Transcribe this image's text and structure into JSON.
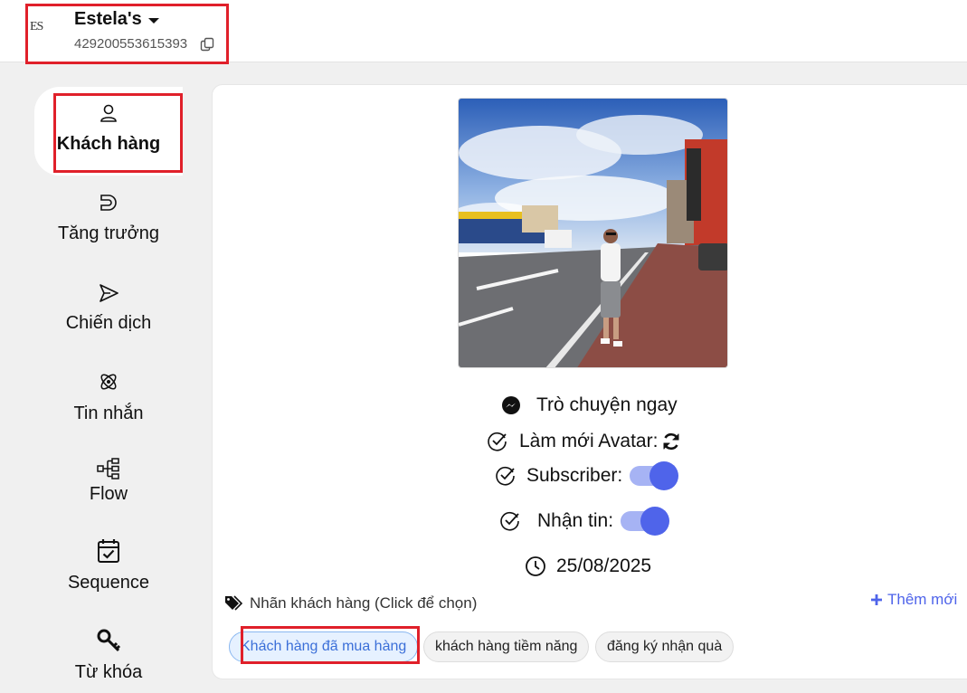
{
  "header": {
    "page_logo_text": "ES",
    "page_name": "Estela's",
    "page_id": "429200553615393"
  },
  "sidebar": {
    "items": [
      {
        "label": "Khách hàng",
        "icon": "user-icon",
        "active": true
      },
      {
        "label": "Tăng trưởng",
        "icon": "magnet-icon"
      },
      {
        "label": "Chiến dịch",
        "icon": "send-icon"
      },
      {
        "label": "Tin nhắn",
        "icon": "atom-icon"
      },
      {
        "label": "Flow",
        "icon": "flow-icon"
      },
      {
        "label": "Sequence",
        "icon": "calendar-check-icon"
      },
      {
        "label": "Từ khóa",
        "icon": "key-icon"
      }
    ]
  },
  "profile": {
    "chat_now": "Trò chuyện ngay",
    "refresh_avatar": "Làm mới Avatar:",
    "subscriber_label": "Subscriber:",
    "subscriber_on": true,
    "receive_label": "Nhận tin:",
    "receive_on": true,
    "date": "25/08/2025"
  },
  "tags": {
    "label": "Nhãn khách hàng (Click để chọn)",
    "add_new": "Thêm mới",
    "chips": [
      {
        "label": "Khách hàng đã mua hàng",
        "selected": true
      },
      {
        "label": "khách hàng tiềm năng",
        "selected": false
      },
      {
        "label": "đăng ký nhận quà",
        "selected": false
      }
    ]
  },
  "colors": {
    "accent": "#4f64ea",
    "highlight_box": "#e0202a",
    "toggle_track": "#a6b3f4"
  }
}
